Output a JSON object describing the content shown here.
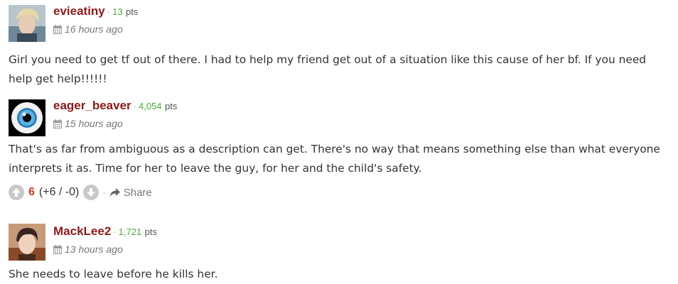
{
  "comments": [
    {
      "username": "evieatiny",
      "points": "13",
      "points_unit": "pts",
      "time": "16 hours ago",
      "avatar": "person-photo-blond",
      "text": "Girl you need to get tf out of there. I had to help my friend get out of a situation like this cause of her bf. If you need help get help!!!!!!"
    },
    {
      "username": "eager_beaver",
      "points": "4,054",
      "points_unit": "pts",
      "time": "15 hours ago",
      "avatar": "eyeball-icon",
      "text": "That's as far from ambiguous as a description can get. There's no way that means something else than what everyone interprets it as. Time for her to leave the guy, for her and the child's safety.",
      "votes": {
        "score": "6",
        "breakdown": "(+6 / -0)",
        "share_label": "Share"
      }
    },
    {
      "username": "MackLee2",
      "points": "1,721",
      "points_unit": "pts",
      "time": "13 hours ago",
      "avatar": "person-photo-dark-hair",
      "text": "She needs to leave before he kills her."
    }
  ],
  "separator": "·",
  "colors": {
    "username": "#8b1a1a",
    "points": "#4caa3c",
    "score": "#c0392b",
    "vote_button": "#c8c8c8"
  }
}
